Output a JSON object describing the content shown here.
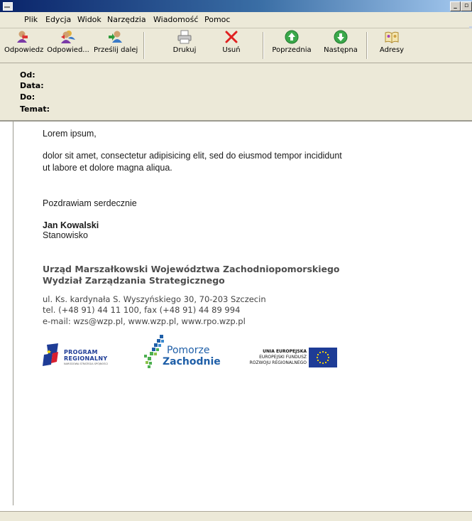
{
  "menu": {
    "items": [
      {
        "label": "Plik"
      },
      {
        "label": "Edycja"
      },
      {
        "label": "Widok"
      },
      {
        "label": "Narzędzia"
      },
      {
        "label": "Wiadomość"
      },
      {
        "label": "Pomoc"
      }
    ]
  },
  "toolbar": {
    "reply": "Odpowiedz",
    "reply_all": "Odpowied...",
    "forward": "Prześlij dalej",
    "print": "Drukuj",
    "delete": "Usuń",
    "previous": "Poprzednia",
    "next": "Następna",
    "addresses": "Adresy"
  },
  "headers": {
    "from": "Od:",
    "date": "Data:",
    "to": "Do:",
    "subject": "Temat:"
  },
  "message": {
    "greeting": "Lorem ipsum,",
    "line1": "dolor sit amet, consectetur adipisicing elit, sed do eiusmod tempor incididunt",
    "line2": "ut labore et dolore magna aliqua.",
    "closing": "Pozdrawiam serdecznie",
    "name": "Jan Kowalski",
    "position": "Stanowisko"
  },
  "signature": {
    "org1": "Urząd Marszałkowski Województwa Zachodniopomorskiego",
    "org2": "Wydział Zarządzania Strategicznego",
    "address": "ul. Ks. kardynała S. Wyszyńskiego 30, 70-203 Szczecin",
    "phone": "tel. (+48 91) 44 11 100, fax (+48 91) 44 89 994",
    "email": "e-mail: wzs@wzp.pl, www.wzp.pl, www.rpo.wzp.pl"
  },
  "logos": {
    "pr_line1": "PROGRAM",
    "pr_line2": "REGIONALNY",
    "pr_line3": "NARODOWA STRATEGIA SPÓJNOŚCI",
    "pz_line1": "Pomorze",
    "pz_line2": "Zachodnie",
    "ue_line1": "UNIA EUROPEJSKA",
    "ue_line2": "EUROPEJSKI FUNDUSZ",
    "ue_line3": "ROZWOJU REGIONALNEGO"
  },
  "colors": {
    "title_bar": "#0a246a",
    "chrome": "#ece9d8",
    "eu_blue": "#1e3c96",
    "eu_star": "#ffdd00",
    "pz_blue": "#1f5fa8",
    "pz_green": "#4caf50"
  }
}
